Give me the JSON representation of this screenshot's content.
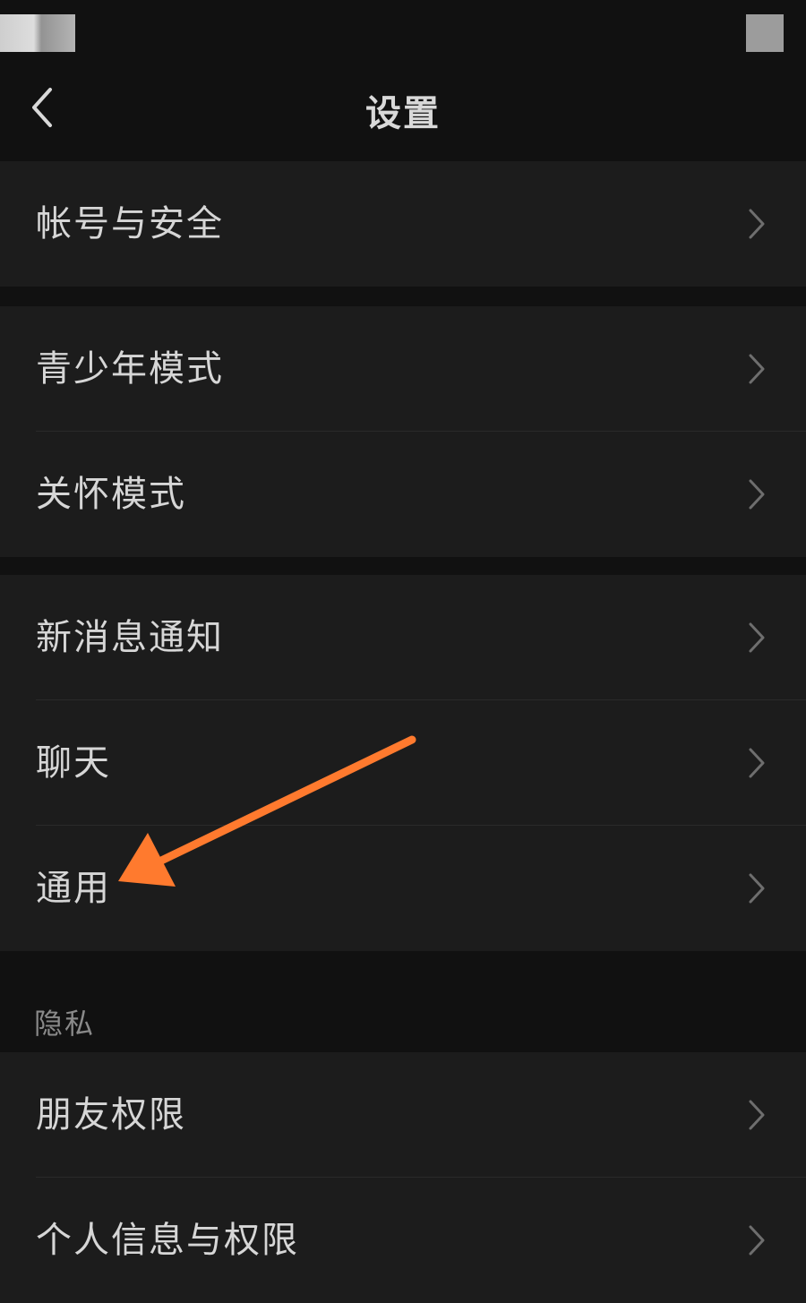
{
  "nav": {
    "title": "设置",
    "back_icon": "chevron-left-icon"
  },
  "groups": [
    {
      "items": [
        {
          "label": "帐号与安全"
        }
      ]
    },
    {
      "items": [
        {
          "label": "青少年模式"
        },
        {
          "label": "关怀模式"
        }
      ]
    },
    {
      "items": [
        {
          "label": "新消息通知"
        },
        {
          "label": "聊天"
        },
        {
          "label": "通用"
        }
      ]
    },
    {
      "header": "隐私",
      "items": [
        {
          "label": "朋友权限"
        },
        {
          "label": "个人信息与权限"
        }
      ]
    }
  ],
  "colors": {
    "background": "#111111",
    "row_background": "#1c1c1c",
    "text": "#d6d6d6",
    "secondary_text": "#8a8a8a",
    "chevron": "#6e6e6e",
    "annotation_arrow": "#ff7a2e"
  },
  "annotation": {
    "icon": "arrow-annotation-icon",
    "points_to": "通用"
  }
}
